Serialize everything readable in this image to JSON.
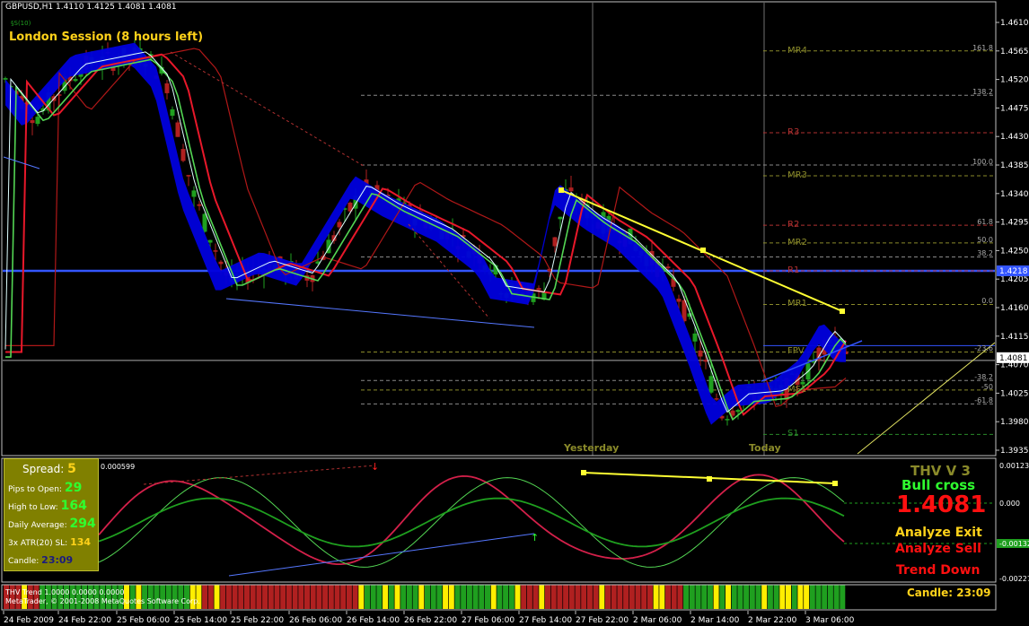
{
  "window": {
    "symbol_header": "GBPUSD,H1  1.4110 1.4125 1.4081 1.4081",
    "small_label": "§S(10)",
    "session_label": "London Session (8 hours left)",
    "copyright": "MetaTrader, © 2001-2008 MetaQuotes Software Corp."
  },
  "price_axis": {
    "labels": [
      "1.4610",
      "1.4565",
      "1.4520",
      "1.4475",
      "1.4430",
      "1.4385",
      "1.4340",
      "1.4295",
      "1.4250",
      "1.4205",
      "1.4160",
      "1.4115",
      "1.4070",
      "1.4025",
      "1.3980",
      "1.3935"
    ],
    "bid_marker": "1.4218",
    "current_price": "1.4081"
  },
  "pivot_levels": [
    {
      "label": "MR4",
      "fib": "161.8",
      "color": "#8a8a2a"
    },
    {
      "label": "",
      "fib": "138.2",
      "color": "#888"
    },
    {
      "label": "R3",
      "fib": "",
      "color": "#b03030"
    },
    {
      "label": "",
      "fib": "100.0",
      "color": "#888"
    },
    {
      "label": "MR3",
      "fib": "",
      "color": "#8a8a2a"
    },
    {
      "label": "R2",
      "fib": "61.8",
      "color": "#b03030"
    },
    {
      "label": "MR2",
      "fib": "50.0",
      "color": "#8a8a2a"
    },
    {
      "label": "",
      "fib": "38.2",
      "color": "#888"
    },
    {
      "label": "R1",
      "fib": "",
      "color": "#b03030"
    },
    {
      "label": "MR1",
      "fib": "0.0",
      "color": "#8a8a2a"
    },
    {
      "label": "FPV",
      "fib": "-23.6",
      "color": "#8a8a2a"
    },
    {
      "label": "",
      "fib": "-38.2",
      "color": "#888"
    },
    {
      "label": "MS1",
      "fib": "-50",
      "color": "#8a8a2a"
    },
    {
      "label": "",
      "fib": "-61.8",
      "color": "#888"
    },
    {
      "label": "S1",
      "fib": "",
      "color": "#2a8a2a"
    }
  ],
  "day_labels": {
    "yesterday": "Yesterday",
    "today": "Today"
  },
  "oscillator": {
    "title": "0.000599",
    "axis": [
      "0.0012372",
      "0.000",
      "-0.00132",
      "-0.0022754"
    ]
  },
  "info_panel": {
    "spread_label": "Spread:",
    "spread_value": "5",
    "pips_to_open_label": "Pips to Open:",
    "pips_to_open_value": "29",
    "high_to_low_label": "High to Low:",
    "high_to_low_value": "164",
    "daily_average_label": "Daily Average:",
    "daily_average_value": "294",
    "atr_label": "3x ATR(20) SL:",
    "atr_value": "134",
    "candle_label": "Candle:",
    "candle_value": "23:09"
  },
  "signal_panel": {
    "title": "THV V 3",
    "cross": "Bull cross",
    "price": "1.4081",
    "exit": "Analyze Exit",
    "sell": "Analyze Sell",
    "trend": "Trend Down"
  },
  "thv_trend": {
    "title": "THV Trend 1.0000 0.0000 0.0000",
    "candle_label": "Candle:",
    "candle_value": "23:09"
  },
  "time_axis": [
    "24 Feb 2009",
    "24 Feb 22:00",
    "25 Feb 06:00",
    "25 Feb 14:00",
    "25 Feb 22:00",
    "26 Feb 06:00",
    "26 Feb 14:00",
    "26 Feb 22:00",
    "27 Feb 06:00",
    "27 Feb 14:00",
    "27 Feb 22:00",
    "2 Mar 06:00",
    "2 Mar 14:00",
    "2 Mar 22:00",
    "3 Mar 06:00"
  ],
  "colors": {
    "bull": "#1f9f1f",
    "bear": "#b02020",
    "ribbon": "#0000dd",
    "fast_ma": "#e8182a",
    "slow_ma": "#c01010",
    "signal_ma": "#53d653",
    "trend_line": "#ffff33",
    "bid_line": "#3355ff"
  }
}
